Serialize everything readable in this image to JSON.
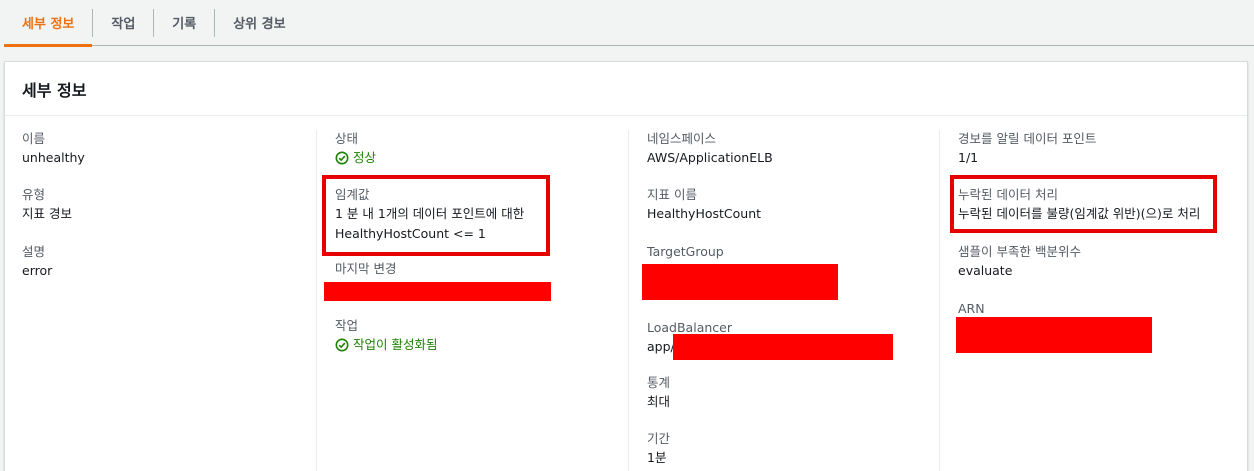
{
  "tabs": [
    {
      "label": "세부 정보"
    },
    {
      "label": "작업"
    },
    {
      "label": "기록"
    },
    {
      "label": "상위 경보"
    }
  ],
  "panel": {
    "title": "세부 정보"
  },
  "col1": {
    "name_label": "이름",
    "name_value": "unhealthy",
    "type_label": "유형",
    "type_value": "지표 경보",
    "desc_label": "설명",
    "desc_value": "error"
  },
  "col2": {
    "state_label": "상태",
    "state_value": "정상",
    "threshold_label": "임계값",
    "threshold_line1": "1 분 내 1개의 데이터 포인트에 대한",
    "threshold_line2": "HealthyHostCount <= 1",
    "last_change_label": "마지막 변경",
    "actions_label": "작업",
    "actions_value": "작업이 활성화됨"
  },
  "col3": {
    "namespace_label": "네임스페이스",
    "namespace_value": "AWS/ApplicationELB",
    "metric_label": "지표 이름",
    "metric_value": "HealthyHostCount",
    "targetgroup_label": "TargetGroup",
    "loadbalancer_label": "LoadBalancer",
    "loadbalancer_prefix": "app/",
    "statistic_label": "통계",
    "statistic_value": "최대",
    "period_label": "기간",
    "period_value": "1분"
  },
  "col4": {
    "datapoints_label": "경보를 알릴 데이터 포인트",
    "datapoints_value": "1/1",
    "missing_label": "누락된 데이터 처리",
    "missing_value": "누락된 데이터를 불량(임계값 위반)(으)로 처리",
    "percentile_label": "샘플이 부족한 백분위수",
    "percentile_value": "evaluate",
    "arn_label": "ARN"
  },
  "colors": {
    "accent": "#ec7211",
    "success": "#1d8102",
    "redaction": "#ff0000"
  },
  "icons": {
    "status": "check-circle-icon"
  }
}
